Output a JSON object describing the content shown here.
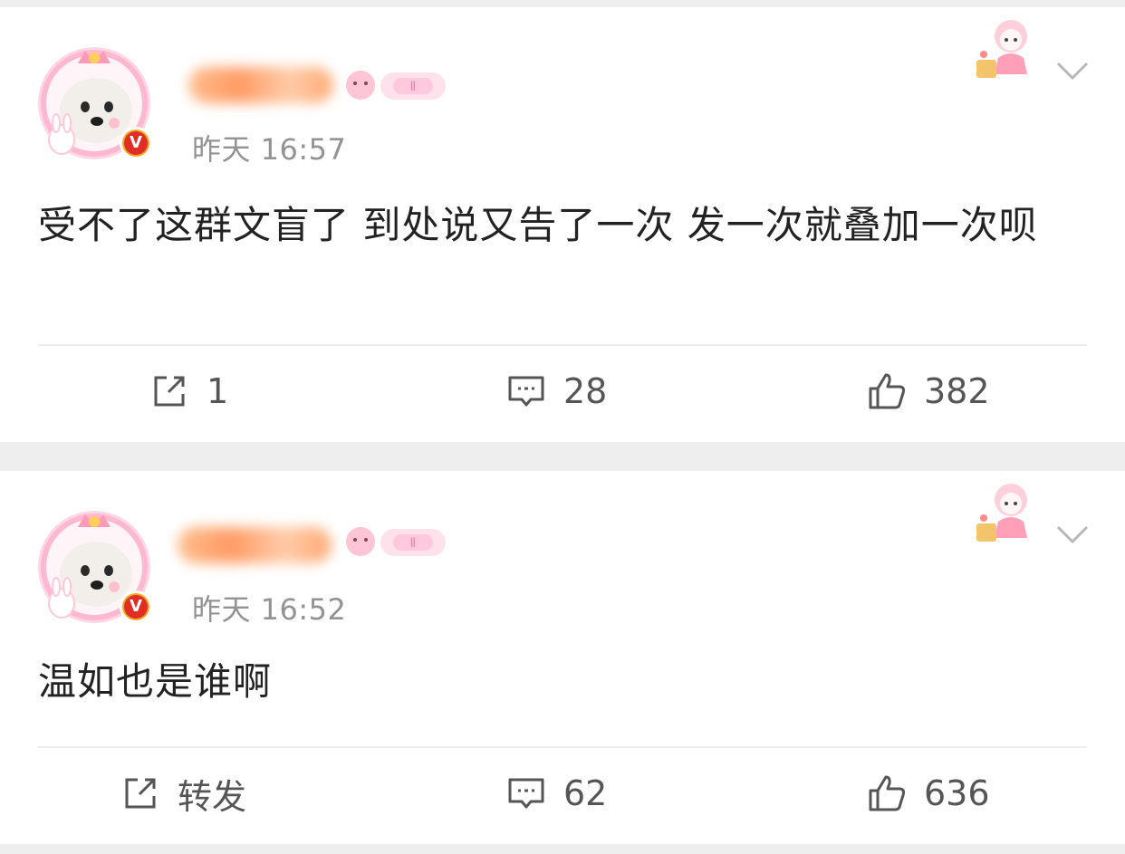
{
  "posts": [
    {
      "time": "昨天 16:57",
      "content": "受不了这群文盲了 到处说又告了一次 发一次就叠加一次呗",
      "actions": {
        "repost": "1",
        "comment": "28",
        "like": "382"
      }
    },
    {
      "time": "昨天 16:52",
      "content": "温如也是谁啊",
      "actions": {
        "repost": "转发",
        "comment": "62",
        "like": "636"
      }
    }
  ],
  "verified_badge": "V",
  "colors": {
    "accent_orange": "#ff8a4a",
    "badge_red": "#e02e24",
    "badge_gold": "#f6a623",
    "time_gray": "#939393",
    "text_dark": "#222222"
  },
  "icons": [
    "avatar-dog-image",
    "verified-badge-icon",
    "sticker-icon",
    "chevron-down-icon",
    "repost-icon",
    "comment-icon",
    "like-icon"
  ]
}
